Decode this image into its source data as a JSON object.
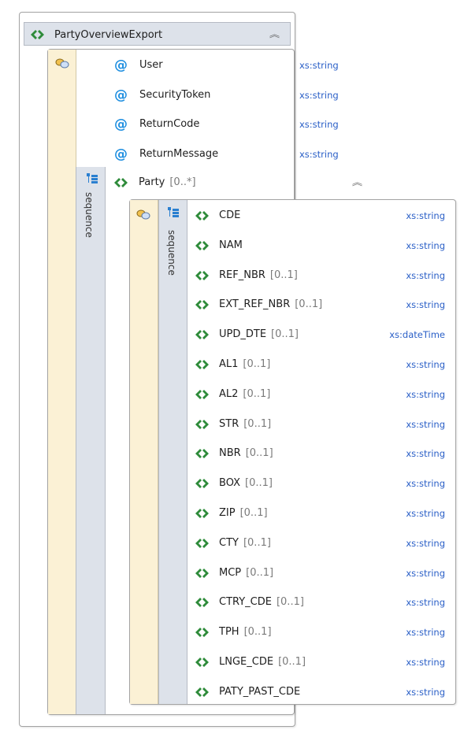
{
  "root": {
    "name": "PartyOverviewExport",
    "icon": "element-icon",
    "attributes": [
      {
        "name": "User",
        "type": "xs:string"
      },
      {
        "name": "SecurityToken",
        "type": "xs:string"
      },
      {
        "name": "ReturnCode",
        "type": "xs:string"
      },
      {
        "name": "ReturnMessage",
        "type": "xs:string"
      }
    ],
    "sequence_label": "sequence",
    "child": {
      "name": "Party",
      "cardinality": "[0..*]",
      "sequence_label": "sequence",
      "elements": [
        {
          "name": "CDE",
          "cardinality": "",
          "type": "xs:string"
        },
        {
          "name": "NAM",
          "cardinality": "",
          "type": "xs:string"
        },
        {
          "name": "REF_NBR",
          "cardinality": "[0..1]",
          "type": "xs:string"
        },
        {
          "name": "EXT_REF_NBR",
          "cardinality": "[0..1]",
          "type": "xs:string"
        },
        {
          "name": "UPD_DTE",
          "cardinality": "[0..1]",
          "type": "xs:dateTime"
        },
        {
          "name": "AL1",
          "cardinality": "[0..1]",
          "type": "xs:string"
        },
        {
          "name": "AL2",
          "cardinality": "[0..1]",
          "type": "xs:string"
        },
        {
          "name": "STR",
          "cardinality": "[0..1]",
          "type": "xs:string"
        },
        {
          "name": "NBR",
          "cardinality": "[0..1]",
          "type": "xs:string"
        },
        {
          "name": "BOX",
          "cardinality": "[0..1]",
          "type": "xs:string"
        },
        {
          "name": "ZIP",
          "cardinality": "[0..1]",
          "type": "xs:string"
        },
        {
          "name": "CTY",
          "cardinality": "[0..1]",
          "type": "xs:string"
        },
        {
          "name": "MCP",
          "cardinality": "[0..1]",
          "type": "xs:string"
        },
        {
          "name": "CTRY_CDE",
          "cardinality": "[0..1]",
          "type": "xs:string"
        },
        {
          "name": "TPH",
          "cardinality": "[0..1]",
          "type": "xs:string"
        },
        {
          "name": "LNGE_CDE",
          "cardinality": "[0..1]",
          "type": "xs:string"
        },
        {
          "name": "PATY_PAST_CDE",
          "cardinality": "",
          "type": "xs:string"
        }
      ]
    }
  },
  "colors": {
    "attribute_icon": "#1f8fe0",
    "element_icon": "#2e8b3a",
    "type_text": "#2a5fc7",
    "header_bg": "#dde2ea",
    "annotation_strip": "#fbf1d5"
  }
}
